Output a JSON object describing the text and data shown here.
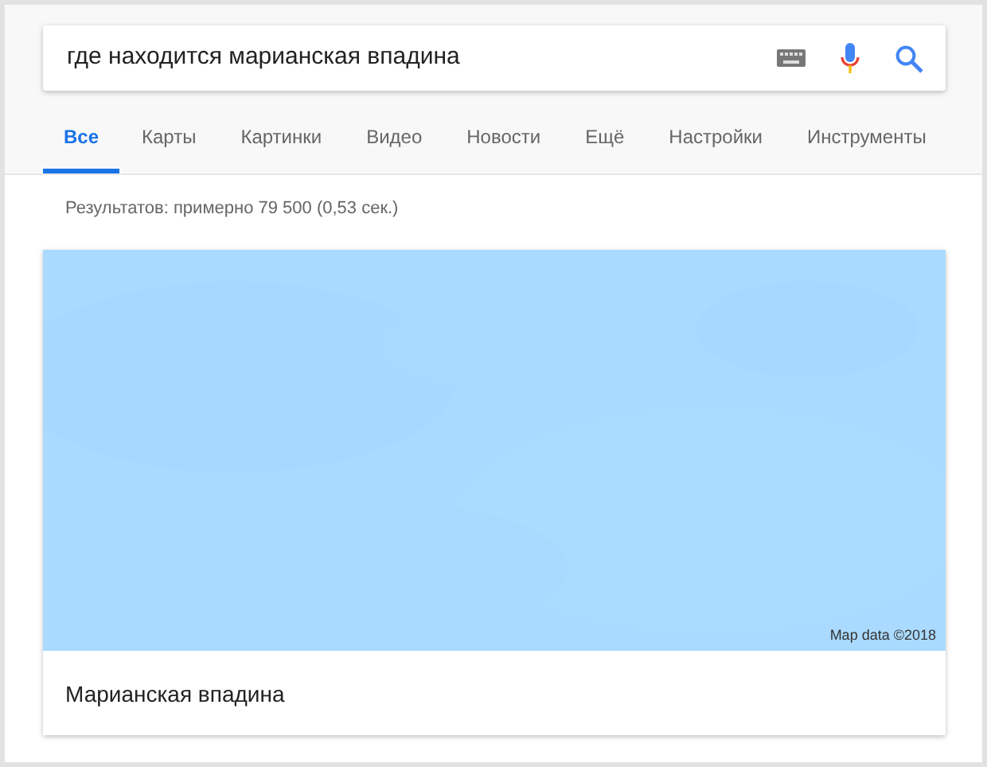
{
  "search": {
    "value": "где находится марианская впадина"
  },
  "tabs": [
    {
      "label": "Все",
      "selected": true
    },
    {
      "label": "Карты",
      "selected": false
    },
    {
      "label": "Картинки",
      "selected": false
    },
    {
      "label": "Видео",
      "selected": false
    },
    {
      "label": "Новости",
      "selected": false
    },
    {
      "label": "Ещё",
      "selected": false
    },
    {
      "label": "Настройки",
      "selected": false
    },
    {
      "label": "Инструменты",
      "selected": false
    }
  ],
  "result_stats": "Результатов: примерно 79 500 (0,53 сек.)",
  "map_card": {
    "attribution": "Map data ©2018",
    "title": "Марианская впадина"
  }
}
